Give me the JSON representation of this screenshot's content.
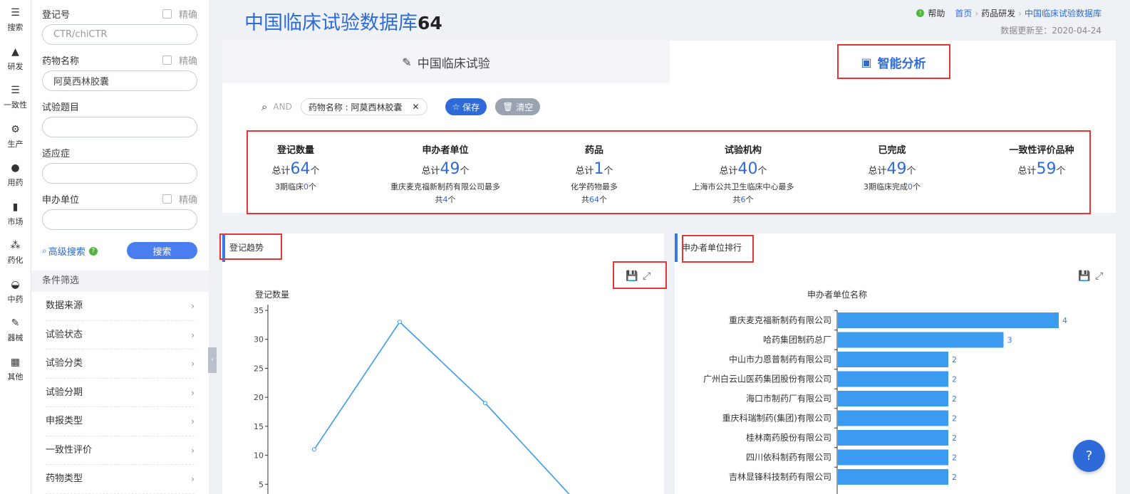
{
  "rail": [
    {
      "icon": "☰",
      "label": "搜索"
    },
    {
      "icon": "▲",
      "label": "研发"
    },
    {
      "icon": "☰",
      "label": "一致性"
    },
    {
      "icon": "⚙",
      "label": "生产"
    },
    {
      "icon": "●",
      "label": "用药"
    },
    {
      "icon": "▮",
      "label": "市场"
    },
    {
      "icon": "⁂",
      "label": "药化"
    },
    {
      "icon": "◒",
      "label": "中药"
    },
    {
      "icon": "✎",
      "label": "器械"
    },
    {
      "icon": "▦",
      "label": "其他"
    }
  ],
  "form": {
    "reg_label": "登记号",
    "reg_placeholder": "CTR/chiCTR",
    "drug_label": "药物名称",
    "drug_value": "阿莫西林胶囊",
    "topic_label": "试验题目",
    "indication_label": "适应症",
    "sponsor_label": "申办单位",
    "exact_label": "精确",
    "advanced": "高级搜索",
    "search_btn": "搜索"
  },
  "filters": {
    "title": "条件筛选",
    "items": [
      "数据来源",
      "试验状态",
      "试验分类",
      "试验分期",
      "申报类型",
      "一致性评价",
      "药物类型"
    ]
  },
  "header": {
    "title": "中国临床试验数据库",
    "count": "64",
    "help": "帮助",
    "crumb_home": "首页",
    "crumb_mid": "药品研发",
    "crumb_current": "中国临床试验数据库",
    "updated": "数据更新至：2020-04-24"
  },
  "tabs": {
    "trial": "中国临床试验",
    "ai": "智能分析"
  },
  "query": {
    "and": "AND",
    "chip": "药物名称 : 阿莫西林胶囊",
    "save": "保存",
    "clear": "清空"
  },
  "stats": [
    {
      "title": "登记数量",
      "pre": "总计",
      "num": "64",
      "unit": "个",
      "sub1a": "3期临床",
      "sub1b": "0",
      "sub1c": "个",
      "sub2a": "",
      "sub2b": "",
      "sub2c": ""
    },
    {
      "title": "申办者单位",
      "pre": "总计",
      "num": "49",
      "unit": "个",
      "sub1a": "重庆麦克福新制药有限公司最多",
      "sub1b": "",
      "sub1c": "",
      "sub2a": "共",
      "sub2b": "4",
      "sub2c": "个"
    },
    {
      "title": "药品",
      "pre": "总计",
      "num": "1",
      "unit": "个",
      "sub1a": "化学药物最多",
      "sub1b": "",
      "sub1c": "",
      "sub2a": "共",
      "sub2b": "64",
      "sub2c": "个"
    },
    {
      "title": "试验机构",
      "pre": "总计",
      "num": "40",
      "unit": "个",
      "sub1a": "上海市公共卫生临床中心最多",
      "sub1b": "",
      "sub1c": "",
      "sub2a": "共",
      "sub2b": "6",
      "sub2c": "个"
    },
    {
      "title": "已完成",
      "pre": "总计",
      "num": "49",
      "unit": "个",
      "sub1a": "3期临床完成",
      "sub1b": "0",
      "sub1c": "个",
      "sub2a": "",
      "sub2b": "",
      "sub2c": ""
    },
    {
      "title": "一致性评价品种",
      "pre": "总计",
      "num": "59",
      "unit": "个",
      "sub1a": "",
      "sub1b": "",
      "sub1c": "",
      "sub2a": "",
      "sub2b": "",
      "sub2c": ""
    }
  ],
  "panels": {
    "trend": "登记趋势",
    "ranking": "申办者单位排行"
  },
  "chart_data": [
    {
      "type": "line",
      "ylabel": "登记数量",
      "ylim": [
        0,
        35
      ],
      "yticks": [
        5,
        10,
        15,
        20,
        25,
        30,
        35
      ],
      "values": [
        11,
        33,
        19,
        3
      ],
      "grid": false,
      "color": "#3a9bf0"
    },
    {
      "type": "bar",
      "orientation": "horizontal",
      "ylabel": "申办者单位名称",
      "xlim": [
        0,
        4
      ],
      "categories": [
        "重庆麦克福新制药有限公司",
        "哈药集团制药总厂",
        "中山市力恩普制药有限公司",
        "广州白云山医药集团股份有限公司",
        "海口市制药厂有限公司",
        "重庆科瑞制药(集团)有限公司",
        "桂林南药股份有限公司",
        "四川依科制药有限公司",
        "吉林显锋科技制药有限公司"
      ],
      "values": [
        4,
        3,
        2,
        2,
        2,
        2,
        2,
        2,
        2
      ],
      "color": "#3a9bf0"
    }
  ],
  "fab_icon": "?"
}
